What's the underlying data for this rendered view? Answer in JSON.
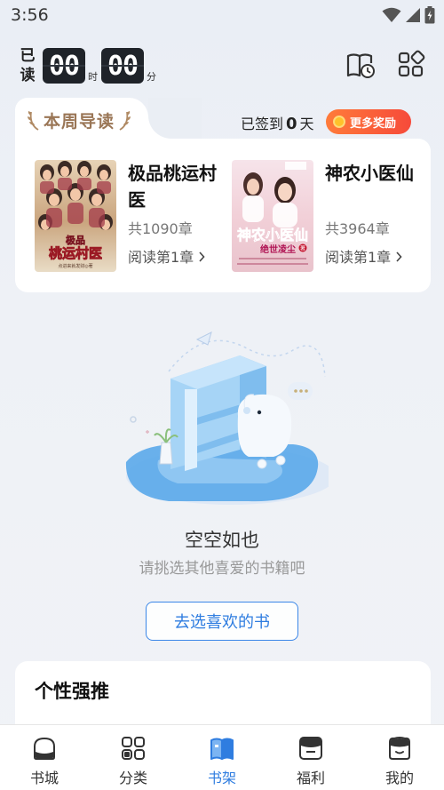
{
  "status_bar": {
    "time": "3:56"
  },
  "reading_time": {
    "label_top": "已",
    "label_bottom": "读",
    "hours": "00",
    "hours_unit": "时",
    "minutes": "00",
    "minutes_unit": "分"
  },
  "header_icons": [
    "reading-history-icon",
    "grid-menu-icon"
  ],
  "guide": {
    "title": "本周导读",
    "signin_prefix": "已签到",
    "signin_days": "0",
    "signin_suffix": "天",
    "reward_label": "更多奖励",
    "books": [
      {
        "title": "极品桃运村医",
        "chapters": "共1090章",
        "read_label": "阅读第1章",
        "cover_title": "极品\n桃运村医",
        "cover_author": "点进来就发财◎著"
      },
      {
        "title": "神农小医仙",
        "chapters": "共3964章",
        "read_label": "阅读第1章",
        "cover_title": "神农小医仙",
        "cover_subtitle": "绝世凌尘",
        "cover_badge": "著"
      }
    ]
  },
  "empty_state": {
    "title": "空空如也",
    "subtitle": "请挑选其他喜爱的书籍吧",
    "button_label": "去选喜欢的书"
  },
  "recommend": {
    "title": "个性强推"
  },
  "tabbar": {
    "active": "书架",
    "accent": "#2f7de0",
    "items": [
      {
        "label": "书城",
        "icon": "bookstore-icon"
      },
      {
        "label": "分类",
        "icon": "category-icon"
      },
      {
        "label": "书架",
        "icon": "bookshelf-icon"
      },
      {
        "label": "福利",
        "icon": "welfare-icon"
      },
      {
        "label": "我的",
        "icon": "profile-icon"
      }
    ]
  }
}
